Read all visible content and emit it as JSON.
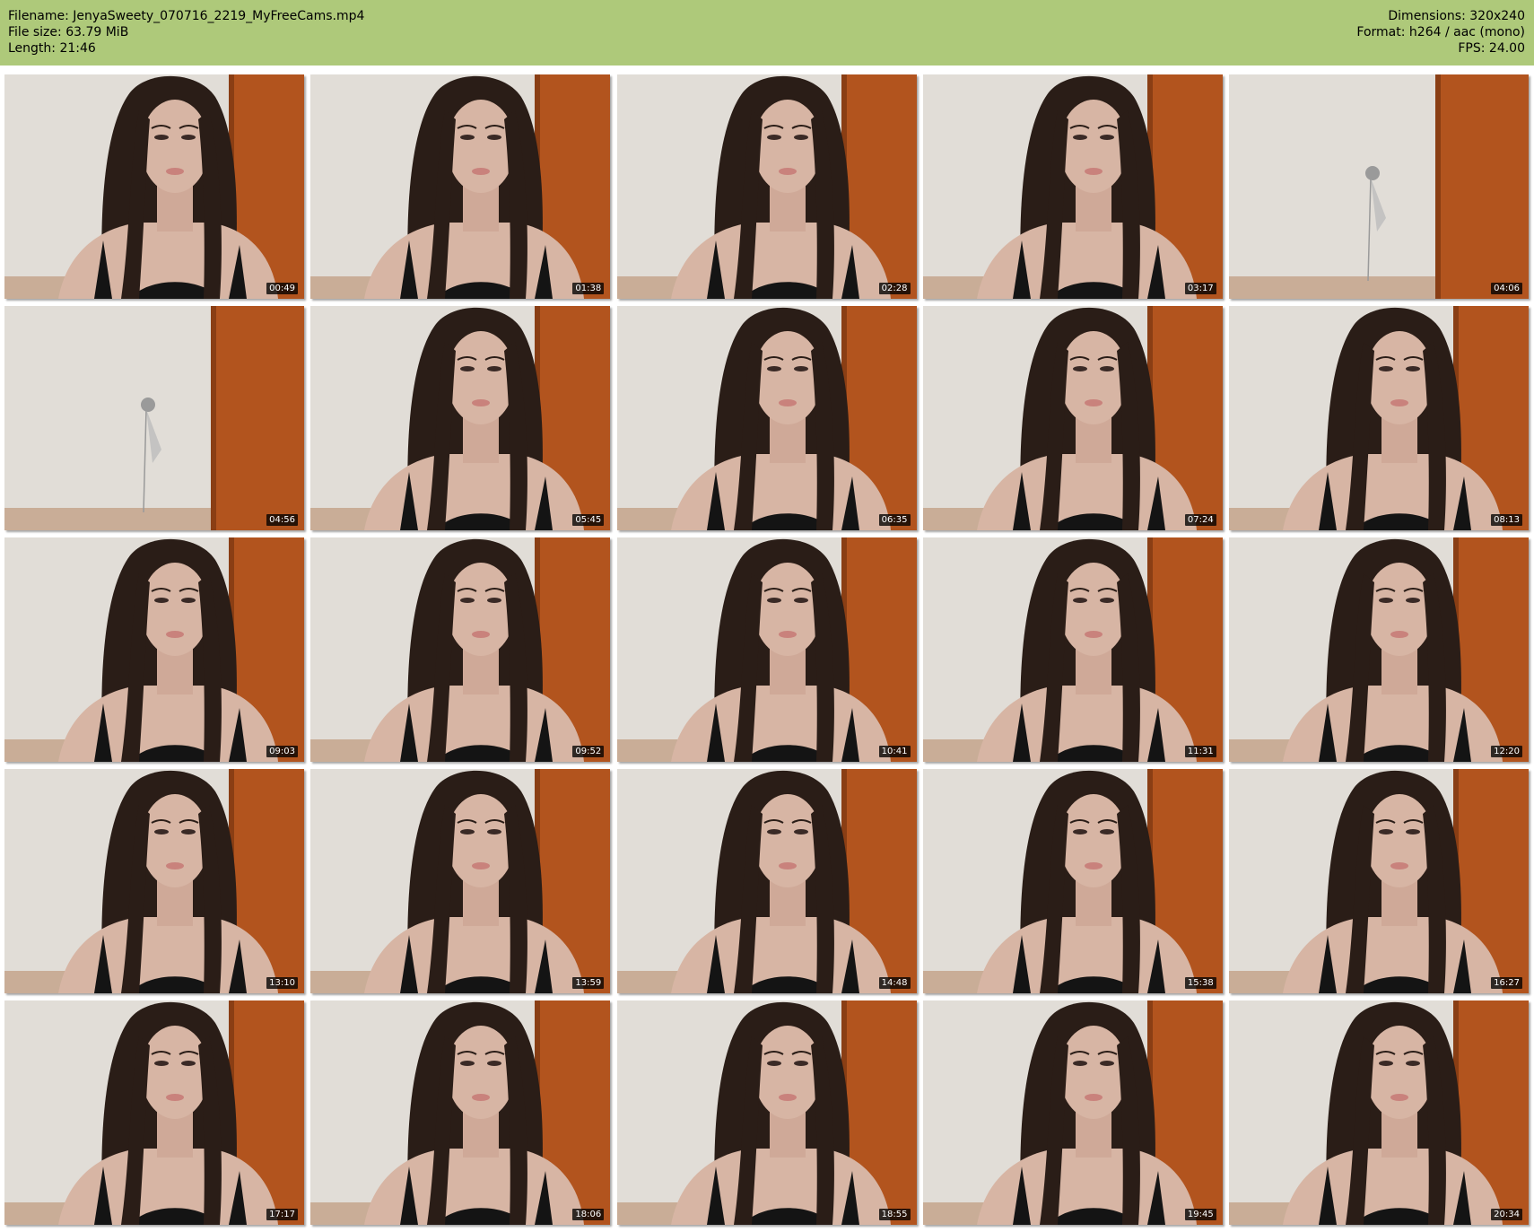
{
  "header": {
    "left": [
      "Filename: JenyaSweety_070716_2219_MyFreeCams.mp4",
      "File size: 63.79 MiB",
      "Length: 21:46"
    ],
    "right": [
      "Dimensions: 320x240",
      "Format: h264 / aac (mono)",
      "FPS: 24.00"
    ]
  },
  "colors": {
    "header_bg": "#aec97a",
    "wall": "#dcd8d2",
    "door": "#b2541e",
    "hair": "#2a1d17",
    "skin": "#d7b5a4",
    "top": "#141414"
  },
  "thumbnails": [
    {
      "time": "00:49",
      "scene": "person"
    },
    {
      "time": "01:38",
      "scene": "person"
    },
    {
      "time": "02:28",
      "scene": "person"
    },
    {
      "time": "03:17",
      "scene": "person"
    },
    {
      "time": "04:06",
      "scene": "empty"
    },
    {
      "time": "04:56",
      "scene": "empty"
    },
    {
      "time": "05:45",
      "scene": "person"
    },
    {
      "time": "06:35",
      "scene": "person"
    },
    {
      "time": "07:24",
      "scene": "person"
    },
    {
      "time": "08:13",
      "scene": "person"
    },
    {
      "time": "09:03",
      "scene": "person"
    },
    {
      "time": "09:52",
      "scene": "person"
    },
    {
      "time": "10:41",
      "scene": "person"
    },
    {
      "time": "11:31",
      "scene": "person"
    },
    {
      "time": "12:20",
      "scene": "person"
    },
    {
      "time": "13:10",
      "scene": "person"
    },
    {
      "time": "13:59",
      "scene": "person"
    },
    {
      "time": "14:48",
      "scene": "person"
    },
    {
      "time": "15:38",
      "scene": "person"
    },
    {
      "time": "16:27",
      "scene": "person"
    },
    {
      "time": "17:17",
      "scene": "person"
    },
    {
      "time": "18:06",
      "scene": "person"
    },
    {
      "time": "18:55",
      "scene": "person"
    },
    {
      "time": "19:45",
      "scene": "person"
    },
    {
      "time": "20:34",
      "scene": "person"
    }
  ]
}
